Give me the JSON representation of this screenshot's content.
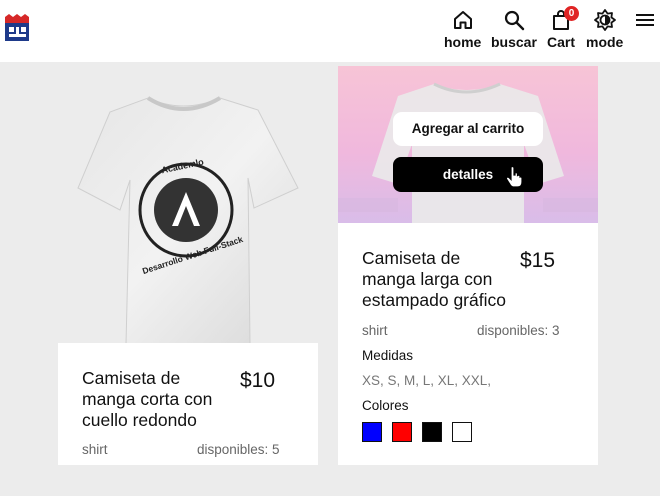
{
  "nav": {
    "home": "home",
    "search": "buscar",
    "cart": "Cart",
    "cart_count": "0",
    "mode": "mode"
  },
  "products": [
    {
      "title_lines": [
        "Camiseta de",
        "manga corta con",
        "cuello redondo"
      ],
      "price": "$10",
      "category": "shirt",
      "stock": "disponibles: 5",
      "print_line1": "Academlo",
      "print_line2": "Desarrollo Web Full-Stack"
    },
    {
      "title_lines": [
        "Camiseta de",
        "manga larga con",
        "estampado gráfico"
      ],
      "price": "$15",
      "category": "shirt",
      "stock": "disponibles: 3",
      "sizes_label": "Medidas",
      "sizes": "XS, S, M, L, XL, XXL,",
      "colors_label": "Colores",
      "colors": [
        "#0000ff",
        "#ff0000",
        "#000000",
        "#ffffff"
      ],
      "add_to_cart": "Agregar al carrito",
      "details": "detalles"
    }
  ],
  "theme": {
    "accent_red": "#e02424",
    "brand_blue": "#1e3a8a",
    "card_bg": "#ffffff",
    "page_bg": "#ececec"
  }
}
